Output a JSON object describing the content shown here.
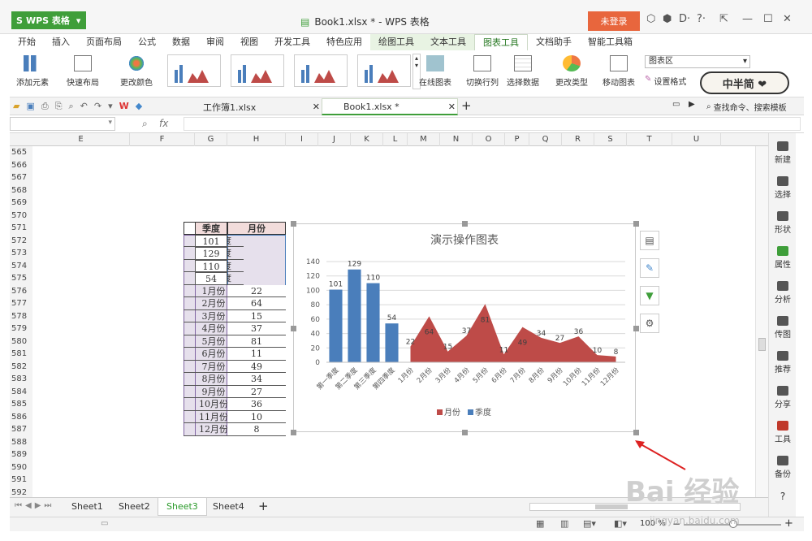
{
  "app": {
    "name": "WPS 表格",
    "title": "Book1.xlsx * - WPS 表格",
    "login_label": "未登录"
  },
  "menu": {
    "items": [
      "开始",
      "插入",
      "页面布局",
      "公式",
      "数据",
      "审阅",
      "视图",
      "开发工具",
      "特色应用",
      "绘图工具",
      "文本工具",
      "图表工具",
      "文档助手",
      "智能工具箱"
    ],
    "active": "图表工具"
  },
  "ribbon": {
    "add_element": "添加元素",
    "quick_layout": "快速布局",
    "change_color": "更改颜色",
    "online_chart": "在线图表",
    "switch_rowcol": "切换行列",
    "select_data": "选择数据",
    "change_type": "更改类型",
    "move_chart": "移动图表",
    "set_format": "设置格式",
    "chart_area": "图表区"
  },
  "doc_tabs": [
    "工作簿1.xlsx",
    "Book1.xlsx *"
  ],
  "search": {
    "placeholder": "查找命令、搜索模板"
  },
  "formula": {
    "fx": "fx"
  },
  "columns": [
    "E",
    "F",
    "G",
    "H",
    "I",
    "J",
    "K",
    "L",
    "M",
    "N",
    "O",
    "P",
    "Q",
    "R",
    "S",
    "T",
    "U"
  ],
  "rows": [
    "565",
    "566",
    "567",
    "568",
    "569",
    "570",
    "571",
    "572",
    "573",
    "574",
    "575",
    "576",
    "577",
    "578",
    "579",
    "580",
    "581",
    "582",
    "583",
    "584",
    "585",
    "586",
    "587",
    "588",
    "589",
    "590",
    "591",
    "592"
  ],
  "table": {
    "header_quarter": "季度",
    "header_month": "月份",
    "rows": [
      {
        "label": "第一季度",
        "quarter": "101",
        "month": ""
      },
      {
        "label": "第二季度",
        "quarter": "129",
        "month": ""
      },
      {
        "label": "第三季度",
        "quarter": "110",
        "month": ""
      },
      {
        "label": "第四季度",
        "quarter": "54",
        "month": ""
      },
      {
        "label": "1月份",
        "quarter": "",
        "month": "22"
      },
      {
        "label": "2月份",
        "quarter": "",
        "month": "64"
      },
      {
        "label": "3月份",
        "quarter": "",
        "month": "15"
      },
      {
        "label": "4月份",
        "quarter": "",
        "month": "37"
      },
      {
        "label": "5月份",
        "quarter": "",
        "month": "81"
      },
      {
        "label": "6月份",
        "quarter": "",
        "month": "11"
      },
      {
        "label": "7月份",
        "quarter": "",
        "month": "49"
      },
      {
        "label": "8月份",
        "quarter": "",
        "month": "34"
      },
      {
        "label": "9月份",
        "quarter": "",
        "month": "27"
      },
      {
        "label": "10月份",
        "quarter": "",
        "month": "36"
      },
      {
        "label": "11月份",
        "quarter": "",
        "month": "10"
      },
      {
        "label": "12月份",
        "quarter": "",
        "month": "8"
      }
    ]
  },
  "chart_data": {
    "type": "bar",
    "title": "演示操作图表",
    "categories": [
      "第一季度",
      "第二季度",
      "第三季度",
      "第四季度",
      "1月份",
      "2月份",
      "3月份",
      "4月份",
      "5月份",
      "6月份",
      "7月份",
      "8月份",
      "9月份",
      "10月份",
      "11月份",
      "12月份"
    ],
    "series": [
      {
        "name": "季度",
        "type": "bar",
        "color": "#4a7ebb",
        "values": [
          101,
          129,
          110,
          54,
          null,
          null,
          null,
          null,
          null,
          null,
          null,
          null,
          null,
          null,
          null,
          null
        ]
      },
      {
        "name": "月份",
        "type": "area",
        "color": "#be4b48",
        "values": [
          null,
          null,
          null,
          null,
          22,
          64,
          15,
          37,
          81,
          11,
          49,
          34,
          27,
          36,
          10,
          8
        ]
      }
    ],
    "ylim": [
      0,
      140
    ],
    "yticks": [
      0,
      20,
      40,
      60,
      80,
      100,
      120,
      140
    ],
    "grid": true,
    "legend": "bottom",
    "legend_entries": [
      "月份",
      "季度"
    ]
  },
  "sheets": [
    "Sheet1",
    "Sheet2",
    "Sheet3",
    "Sheet4"
  ],
  "active_sheet": "Sheet3",
  "right_panel": [
    "新建",
    "选择",
    "形状",
    "属性",
    "分析",
    "传图",
    "推荐",
    "分享",
    "工具",
    "备份"
  ],
  "zoom": {
    "label": "100 %"
  },
  "badge": {
    "text": "中半简 ❤"
  },
  "watermark": {
    "text": "Bai 经验",
    "url": "jingyan.baidu.com"
  }
}
